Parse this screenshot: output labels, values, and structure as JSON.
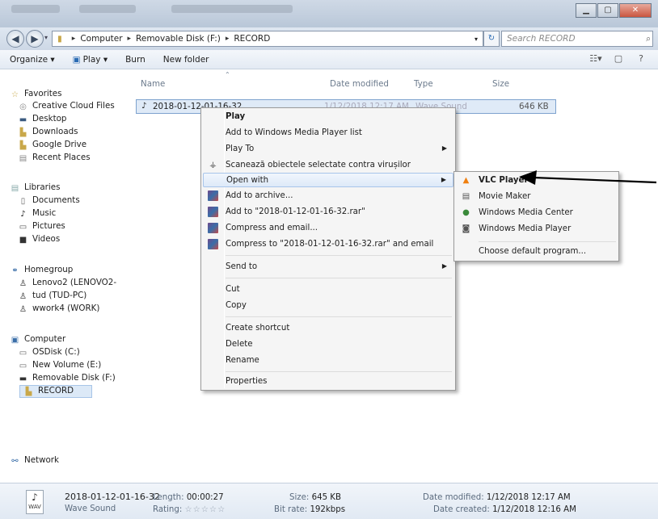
{
  "window": {
    "buttons": {
      "minimize": "▁",
      "maximize": "▢",
      "close": "✕"
    }
  },
  "address": {
    "breadcrumbs": [
      "Computer",
      "Removable Disk (F:)",
      "RECORD"
    ],
    "search_placeholder": "Search RECORD"
  },
  "toolbar": {
    "organize": "Organize ▾",
    "play": "Play ▾",
    "burn": "Burn",
    "new_folder": "New folder"
  },
  "nav": {
    "favorites": "Favorites",
    "creative_cloud": "Creative Cloud Files",
    "desktop": "Desktop",
    "downloads": "Downloads",
    "google_drive": "Google Drive",
    "recent_places": "Recent Places",
    "libraries": "Libraries",
    "documents": "Documents",
    "music": "Music",
    "pictures": "Pictures",
    "videos": "Videos",
    "homegroup": "Homegroup",
    "lenovo": "Lenovo2 (LENOVO2-",
    "tud": "tud (TUD-PC)",
    "wwork": "wwork4 (WORK)",
    "computer": "Computer",
    "osdisk": "OSDisk (C:)",
    "newvolume": "New Volume (E:)",
    "removable": "Removable Disk (F:)",
    "record": "RECORD",
    "network": "Network"
  },
  "columns": {
    "name": "Name",
    "date": "Date modified",
    "type": "Type",
    "size": "Size"
  },
  "file": {
    "name": "2018-01-12-01-16-32",
    "date": "1/12/2018 12:17 AM",
    "type": "Wave Sound",
    "size": "646 KB"
  },
  "context_menu": {
    "play": "Play",
    "add_wmp": "Add to Windows Media Player list",
    "play_to": "Play To",
    "scan": "Scanează obiectele selectate contra virușilor",
    "open_with": "Open with",
    "add_archive": "Add to archive...",
    "add_rar": "Add to \"2018-01-12-01-16-32.rar\"",
    "compress_email": "Compress and email...",
    "compress_rar_email": "Compress to \"2018-01-12-01-16-32.rar\" and email",
    "send_to": "Send to",
    "cut": "Cut",
    "copy": "Copy",
    "create_shortcut": "Create shortcut",
    "delete": "Delete",
    "rename": "Rename",
    "properties": "Properties"
  },
  "open_with_menu": {
    "vlc": "VLC Player",
    "movie_maker": "Movie Maker",
    "wmc": "Windows Media Center",
    "wmp": "Windows Media Player",
    "choose_default": "Choose default program..."
  },
  "details": {
    "filename": "2018-01-12-01-16-32",
    "type": "Wave Sound",
    "length_label": "Length:",
    "length": "00:00:27",
    "rating_label": "Rating:",
    "rating_stars": "☆☆☆☆☆",
    "size_label": "Size:",
    "size": "645 KB",
    "bitrate_label": "Bit rate:",
    "bitrate": "192kbps",
    "modified_label": "Date modified:",
    "modified": "1/12/2018 12:17 AM",
    "created_label": "Date created:",
    "created": "1/12/2018 12:16 AM",
    "icon_label": "WAV"
  },
  "colors": {
    "accent": "#3a6ea8",
    "highlight": "#dde9f8",
    "vlc": "#f07f0f"
  }
}
